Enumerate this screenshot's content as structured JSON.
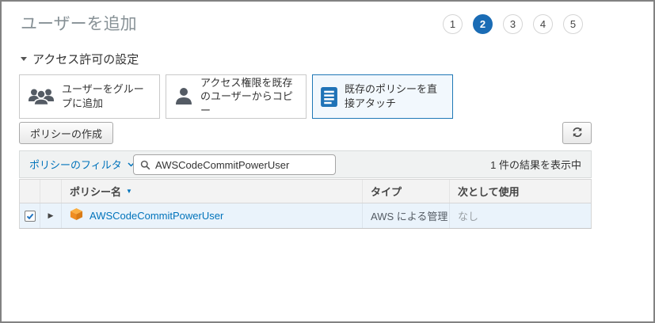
{
  "page": {
    "title": "ユーザーを追加"
  },
  "steps": {
    "items": [
      "1",
      "2",
      "3",
      "4",
      "5"
    ],
    "active_step": "2"
  },
  "section": {
    "title": "アクセス許可の設定"
  },
  "options": {
    "cards": [
      {
        "label": "ユーザーをグループに追加",
        "icon": "user-group-icon",
        "selected": false
      },
      {
        "label": "アクセス権限を既存のユーザーからコピー",
        "icon": "user-icon",
        "selected": false
      },
      {
        "label": "既存のポリシーを直接アタッチ",
        "icon": "policy-document-icon",
        "selected": true
      }
    ]
  },
  "toolbar": {
    "create_policy_label": "ポリシーの作成",
    "refresh_icon": "refresh-icon"
  },
  "filter": {
    "dropdown_label": "ポリシーのフィルタ",
    "search_icon": "search-icon",
    "search_value": "AWSCodeCommitPowerUser",
    "results_text": "1 件の結果を表示中"
  },
  "table": {
    "headers": {
      "policy_name": "ポリシー名",
      "type": "タイプ",
      "used_as": "次として使用"
    },
    "rows": [
      {
        "checked": true,
        "policy_name": "AWSCodeCommitPowerUser",
        "type": "AWS による管理",
        "used_as": "なし"
      }
    ]
  },
  "icons": {
    "sort_arrow": "▼",
    "expand_arrow": "▶"
  },
  "colors": {
    "link_blue": "#0073bb",
    "step_active_blue": "#1a6cb5",
    "selected_card_border": "#1f78b6",
    "selected_row_bg": "#eaf3fb",
    "policy_cube_orange": "#ef8d22",
    "icon_gray": "#545b64"
  }
}
